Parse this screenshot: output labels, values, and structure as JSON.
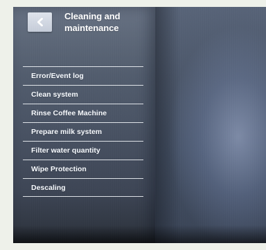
{
  "header": {
    "title_line_1": "Cleaning and",
    "title_line_2": "maintenance"
  },
  "icons": {
    "back": "chevron-left-icon"
  },
  "menu": {
    "items": [
      {
        "label": "Error/Event log"
      },
      {
        "label": "Clean system"
      },
      {
        "label": "Rinse Coffee Machine"
      },
      {
        "label": "Prepare milk system"
      },
      {
        "label": "Filter water quantity"
      },
      {
        "label": "Wipe Protection"
      },
      {
        "label": "Descaling"
      }
    ]
  },
  "colors": {
    "panel_left": "#4a5465",
    "panel_right": "#4d586a",
    "text": "#f8fbff",
    "divider": "#f5f8fc",
    "back_button": "#d3d9e3"
  }
}
